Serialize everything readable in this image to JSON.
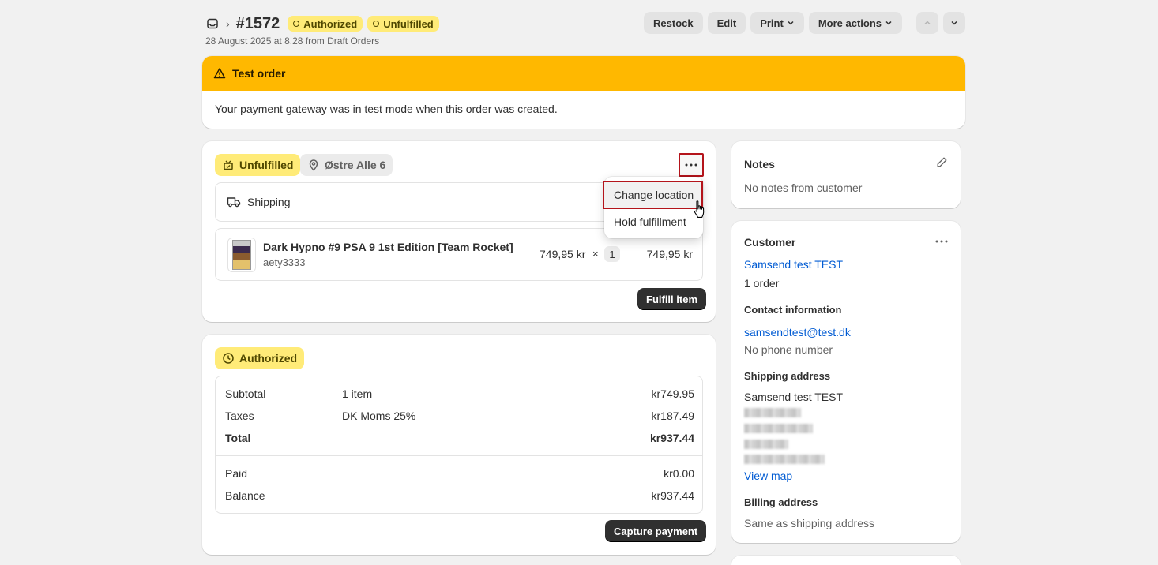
{
  "header": {
    "breadcrumb_icon": "inbox-icon",
    "order_number": "#1572",
    "badges": [
      "Authorized",
      "Unfulfilled"
    ],
    "subtitle": "28 August 2025 at 8.28 from Draft Orders",
    "actions": {
      "restock": "Restock",
      "edit": "Edit",
      "print": "Print",
      "more_actions": "More actions"
    }
  },
  "banner": {
    "title": "Test order",
    "message": "Your payment gateway was in test mode when this order was created."
  },
  "fulfillment": {
    "status": "Unfulfilled",
    "location": "Østre Alle 6",
    "shipping_label": "Shipping",
    "item": {
      "title": "Dark Hypno #9 PSA 9 1st Edition [Team Rocket]",
      "sku": "aety3333",
      "price": "749,95 kr",
      "times": "×",
      "quantity": "1",
      "total": "749,95 kr"
    },
    "fulfill_button": "Fulfill item"
  },
  "dropdown": {
    "items": [
      "Change location",
      "Hold fulfillment"
    ]
  },
  "payment": {
    "status": "Authorized",
    "rows": [
      {
        "label": "Subtotal",
        "middle": "1 item",
        "value": "kr749.95"
      },
      {
        "label": "Taxes",
        "middle": "DK Moms 25%",
        "value": "kr187.49"
      },
      {
        "label": "Total",
        "middle": "",
        "value": "kr937.44"
      }
    ],
    "rows2": [
      {
        "label": "Paid",
        "value": "kr0.00"
      },
      {
        "label": "Balance",
        "value": "kr937.44"
      }
    ],
    "capture_button": "Capture payment"
  },
  "notes": {
    "title": "Notes",
    "text": "No notes from customer"
  },
  "customer": {
    "title": "Customer",
    "name": "Samsend test TEST",
    "orders": "1 order",
    "contact_title": "Contact information",
    "email": "samsendtest@test.dk",
    "phone": "No phone number",
    "shipping_title": "Shipping address",
    "shipping_name": "Samsend test TEST",
    "view_map": "View map",
    "billing_title": "Billing address",
    "billing_text": "Same as shipping address"
  },
  "colors": {
    "banner": "#ffb800",
    "badge_yellow": "#ffeb78",
    "link": "#005bd3",
    "highlight": "#b4141b"
  }
}
